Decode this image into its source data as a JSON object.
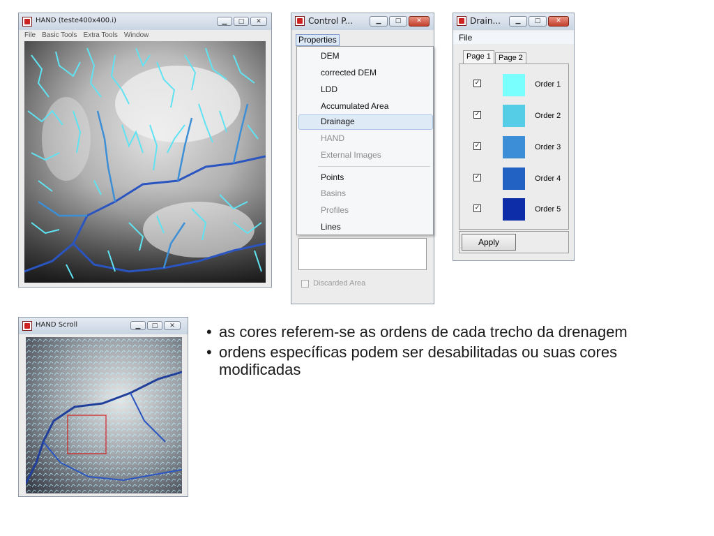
{
  "hand_window": {
    "title": "HAND (teste400x400.i)",
    "menu": [
      "File",
      "Basic Tools",
      "Extra Tools",
      "Window"
    ]
  },
  "control_window": {
    "title": "Control P...",
    "menu_button": "Properties",
    "menu_items": [
      {
        "label": "DEM",
        "enabled": true
      },
      {
        "label": "corrected DEM",
        "enabled": true
      },
      {
        "label": "LDD",
        "enabled": true
      },
      {
        "label": "Accumulated Area",
        "enabled": true
      },
      {
        "label": "Drainage",
        "enabled": true,
        "highlighted": true
      },
      {
        "label": "HAND",
        "enabled": false
      },
      {
        "label": "External Images",
        "enabled": false
      },
      {
        "label": "Points",
        "enabled": true
      },
      {
        "label": "Basins",
        "enabled": false
      },
      {
        "label": "Profiles",
        "enabled": false
      },
      {
        "label": "Lines",
        "enabled": true
      }
    ],
    "discarded_label": "Discarded Area"
  },
  "drainage_window": {
    "title": "Drain...",
    "menu": "File",
    "tabs": [
      "Page 1",
      "Page 2"
    ],
    "orders": [
      {
        "label": "Order 1",
        "color": "#7affff",
        "checked": true
      },
      {
        "label": "Order 2",
        "color": "#55cde6",
        "checked": true
      },
      {
        "label": "Order 3",
        "color": "#3c8fd6",
        "checked": true
      },
      {
        "label": "Order 4",
        "color": "#2262c2",
        "checked": true
      },
      {
        "label": "Order 5",
        "color": "#0d2da8",
        "checked": true
      }
    ],
    "apply_label": "Apply"
  },
  "scroll_window": {
    "title": "HAND Scroll"
  },
  "bullets": [
    "as cores referem-se as ordens de cada trecho da drenagem",
    "ordens específicas podem ser desabilitadas ou suas cores modificadas"
  ]
}
